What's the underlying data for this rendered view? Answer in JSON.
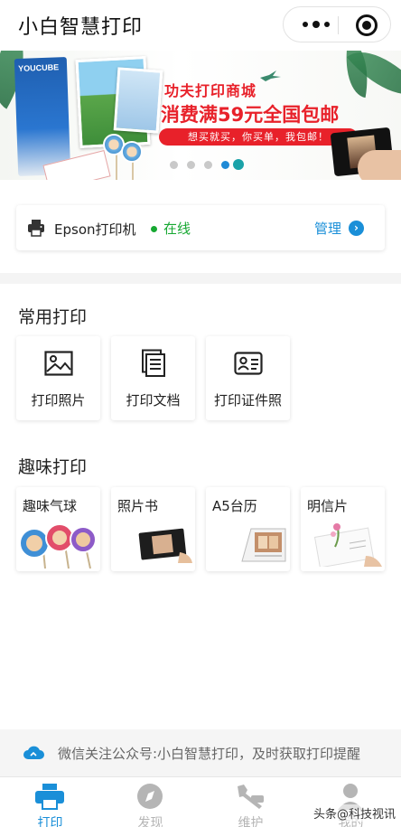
{
  "header": {
    "title": "小白智慧打印",
    "more_icon": "more-dots-icon",
    "close_icon": "target-close-icon"
  },
  "banner": {
    "headline": "功夫打印商城",
    "offer": "消费满59元全国包邮",
    "slogan": "想买就买，你买单，我包邮！",
    "paper_brand": "YOUCUBE",
    "carousel": {
      "count": 5,
      "active_index": 3
    },
    "accent_color": "#e8212a"
  },
  "printer": {
    "name": "Epson打印机",
    "status": "在线",
    "manage_label": "管理",
    "status_color": "#17a832",
    "link_color": "#1a8fd8"
  },
  "common_print": {
    "title": "常用打印",
    "items": [
      {
        "label": "打印照片",
        "icon": "photo-icon"
      },
      {
        "label": "打印文档",
        "icon": "document-icon"
      },
      {
        "label": "打印证件照",
        "icon": "id-card-icon"
      }
    ]
  },
  "fun_print": {
    "title": "趣味打印",
    "items": [
      {
        "label": "趣味气球",
        "icon": "balloon-photo-image"
      },
      {
        "label": "照片书",
        "icon": "photo-book-image"
      },
      {
        "label": "A5台历",
        "icon": "desk-calendar-image"
      },
      {
        "label": "明信片",
        "icon": "postcard-image"
      }
    ]
  },
  "notice": {
    "text": "微信关注公众号:小白智慧打印，及时获取打印提醒",
    "icon": "cloud-icon"
  },
  "tabbar": {
    "items": [
      {
        "label": "打印",
        "icon": "printer-icon",
        "active": true
      },
      {
        "label": "发现",
        "icon": "compass-icon",
        "active": false
      },
      {
        "label": "维护",
        "icon": "wrench-icon",
        "active": false
      },
      {
        "label": "我的",
        "icon": "user-icon",
        "active": false
      }
    ],
    "active_color": "#1a8fd8",
    "inactive_color": "#b5b5b5"
  },
  "watermark": "头条@科技视讯"
}
